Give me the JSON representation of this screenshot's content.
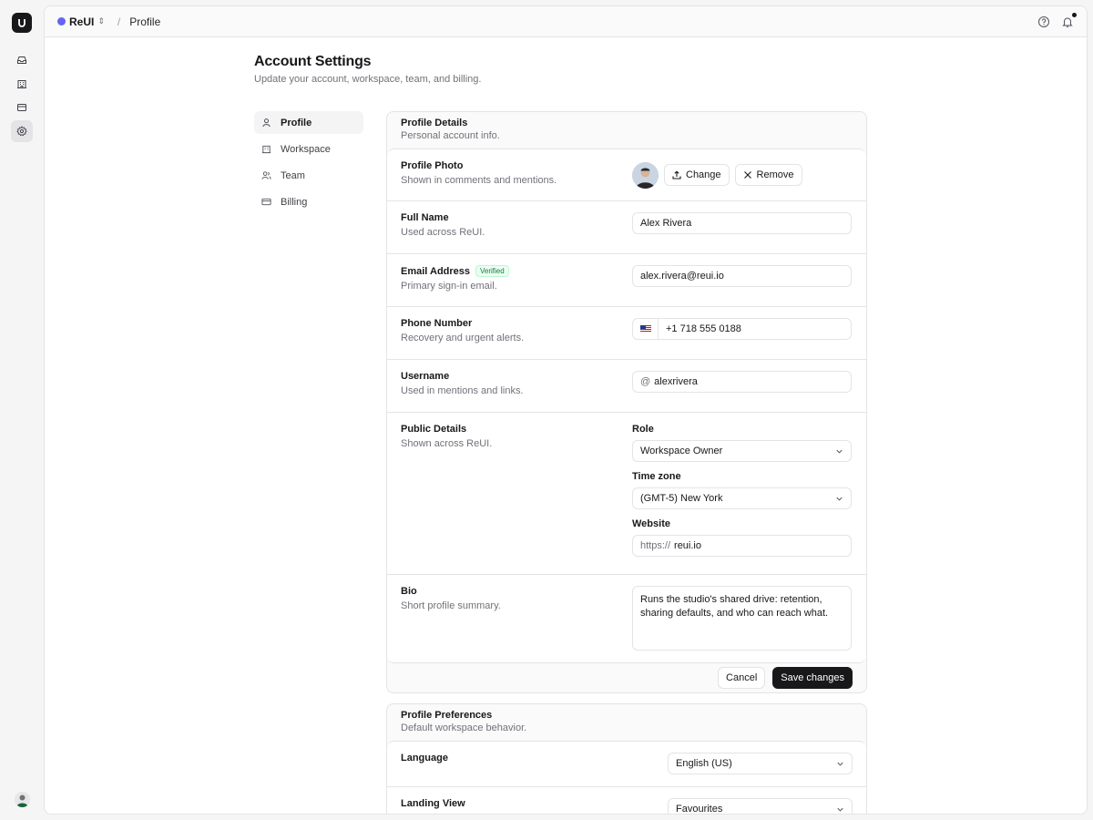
{
  "topbar": {
    "workspace": "ReUI",
    "breadcrumb_sep": "/",
    "breadcrumb": "Profile"
  },
  "rail": {
    "items": [
      "inbox-icon",
      "building-icon",
      "card-icon",
      "settings-icon"
    ],
    "active": "settings-icon"
  },
  "page": {
    "title": "Account Settings",
    "subtitle": "Update your account, workspace, team, and billing."
  },
  "subnav": {
    "items": [
      {
        "label": "Profile",
        "icon": "user-icon",
        "active": true
      },
      {
        "label": "Workspace",
        "icon": "building-icon",
        "active": false
      },
      {
        "label": "Team",
        "icon": "users-icon",
        "active": false
      },
      {
        "label": "Billing",
        "icon": "card-icon",
        "active": false
      }
    ]
  },
  "profile_details": {
    "title": "Profile Details",
    "subtitle": "Personal account info.",
    "photo": {
      "label": "Profile Photo",
      "desc": "Shown in comments and mentions.",
      "change": "Change",
      "remove": "Remove"
    },
    "full_name": {
      "label": "Full Name",
      "desc": "Used across ReUI.",
      "value": "Alex Rivera"
    },
    "email": {
      "label": "Email Address",
      "badge": "Verified",
      "desc": "Primary sign-in email.",
      "value": "alex.rivera@reui.io"
    },
    "phone": {
      "label": "Phone Number",
      "desc": "Recovery and urgent alerts.",
      "value": "+1 718 555 0188"
    },
    "username": {
      "label": "Username",
      "desc": "Used in mentions and links.",
      "prefix": "@",
      "value": "alexrivera"
    },
    "public": {
      "label": "Public Details",
      "desc": "Shown across ReUI.",
      "role_label": "Role",
      "role": "Workspace Owner",
      "tz_label": "Time zone",
      "tz": "(GMT-5) New York",
      "website_label": "Website",
      "website_prefix": "https://",
      "website": "reui.io"
    },
    "bio": {
      "label": "Bio",
      "desc": "Short profile summary.",
      "value": "Runs the studio's shared drive: retention, sharing defaults, and who can reach what."
    },
    "cancel": "Cancel",
    "save": "Save changes"
  },
  "preferences": {
    "title": "Profile Preferences",
    "subtitle": "Default workspace behavior.",
    "language_label": "Language",
    "language": "English (US)",
    "landing_label": "Landing View",
    "landing": "Favourites"
  }
}
